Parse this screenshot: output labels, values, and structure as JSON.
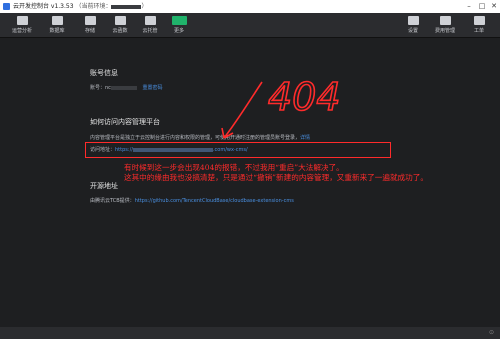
{
  "titlebar": {
    "title": "云开发控制台 v1.3.53",
    "env_label": "（当前环境：",
    "env_suffix": "）"
  },
  "toolbar": {
    "left": [
      {
        "label": "运营分析",
        "icon": "chart-icon"
      },
      {
        "label": "数据库",
        "icon": "database-icon"
      },
      {
        "label": "存储",
        "icon": "storage-icon"
      },
      {
        "label": "云函数",
        "icon": "function-icon"
      },
      {
        "label": "云托管",
        "icon": "hosting-icon"
      },
      {
        "label": "更多",
        "icon": "more-icon"
      }
    ],
    "right": [
      {
        "label": "设置",
        "icon": "settings-icon"
      },
      {
        "label": "费用管理",
        "icon": "billing-icon"
      },
      {
        "label": "工单",
        "icon": "ticket-icon"
      }
    ],
    "active_color": "#20b36b"
  },
  "account": {
    "heading": "账号信息",
    "label": "账号：",
    "value_prefix": "nc",
    "reset_link": "重置密码"
  },
  "access": {
    "heading": "如何访问内容管理平台",
    "description": "内容管理平台是独立于云控制台进行内容和权限的管理，可使用开通时注册的管理员账号登录，",
    "detail_link": "详情",
    "url_label": "访问地址：",
    "url_prefix": "https://",
    "url_suffix": ".com/wx-cms/"
  },
  "source": {
    "heading": "开源地址",
    "text": "由腾讯云TCB提供：",
    "link": "https://github.com/TencentCloudBase/cloudbase-extension-cms"
  },
  "annotation": {
    "big_text": "404",
    "line1": "有时候到这一步会出现404的报错，不过我用“重启”大法解决了。",
    "line2": "这其中的缘由我也没搞清楚，只是通过“撤销”新建的内容管理，又重新来了一遍就成功了。",
    "color": "#ff2b2b"
  }
}
